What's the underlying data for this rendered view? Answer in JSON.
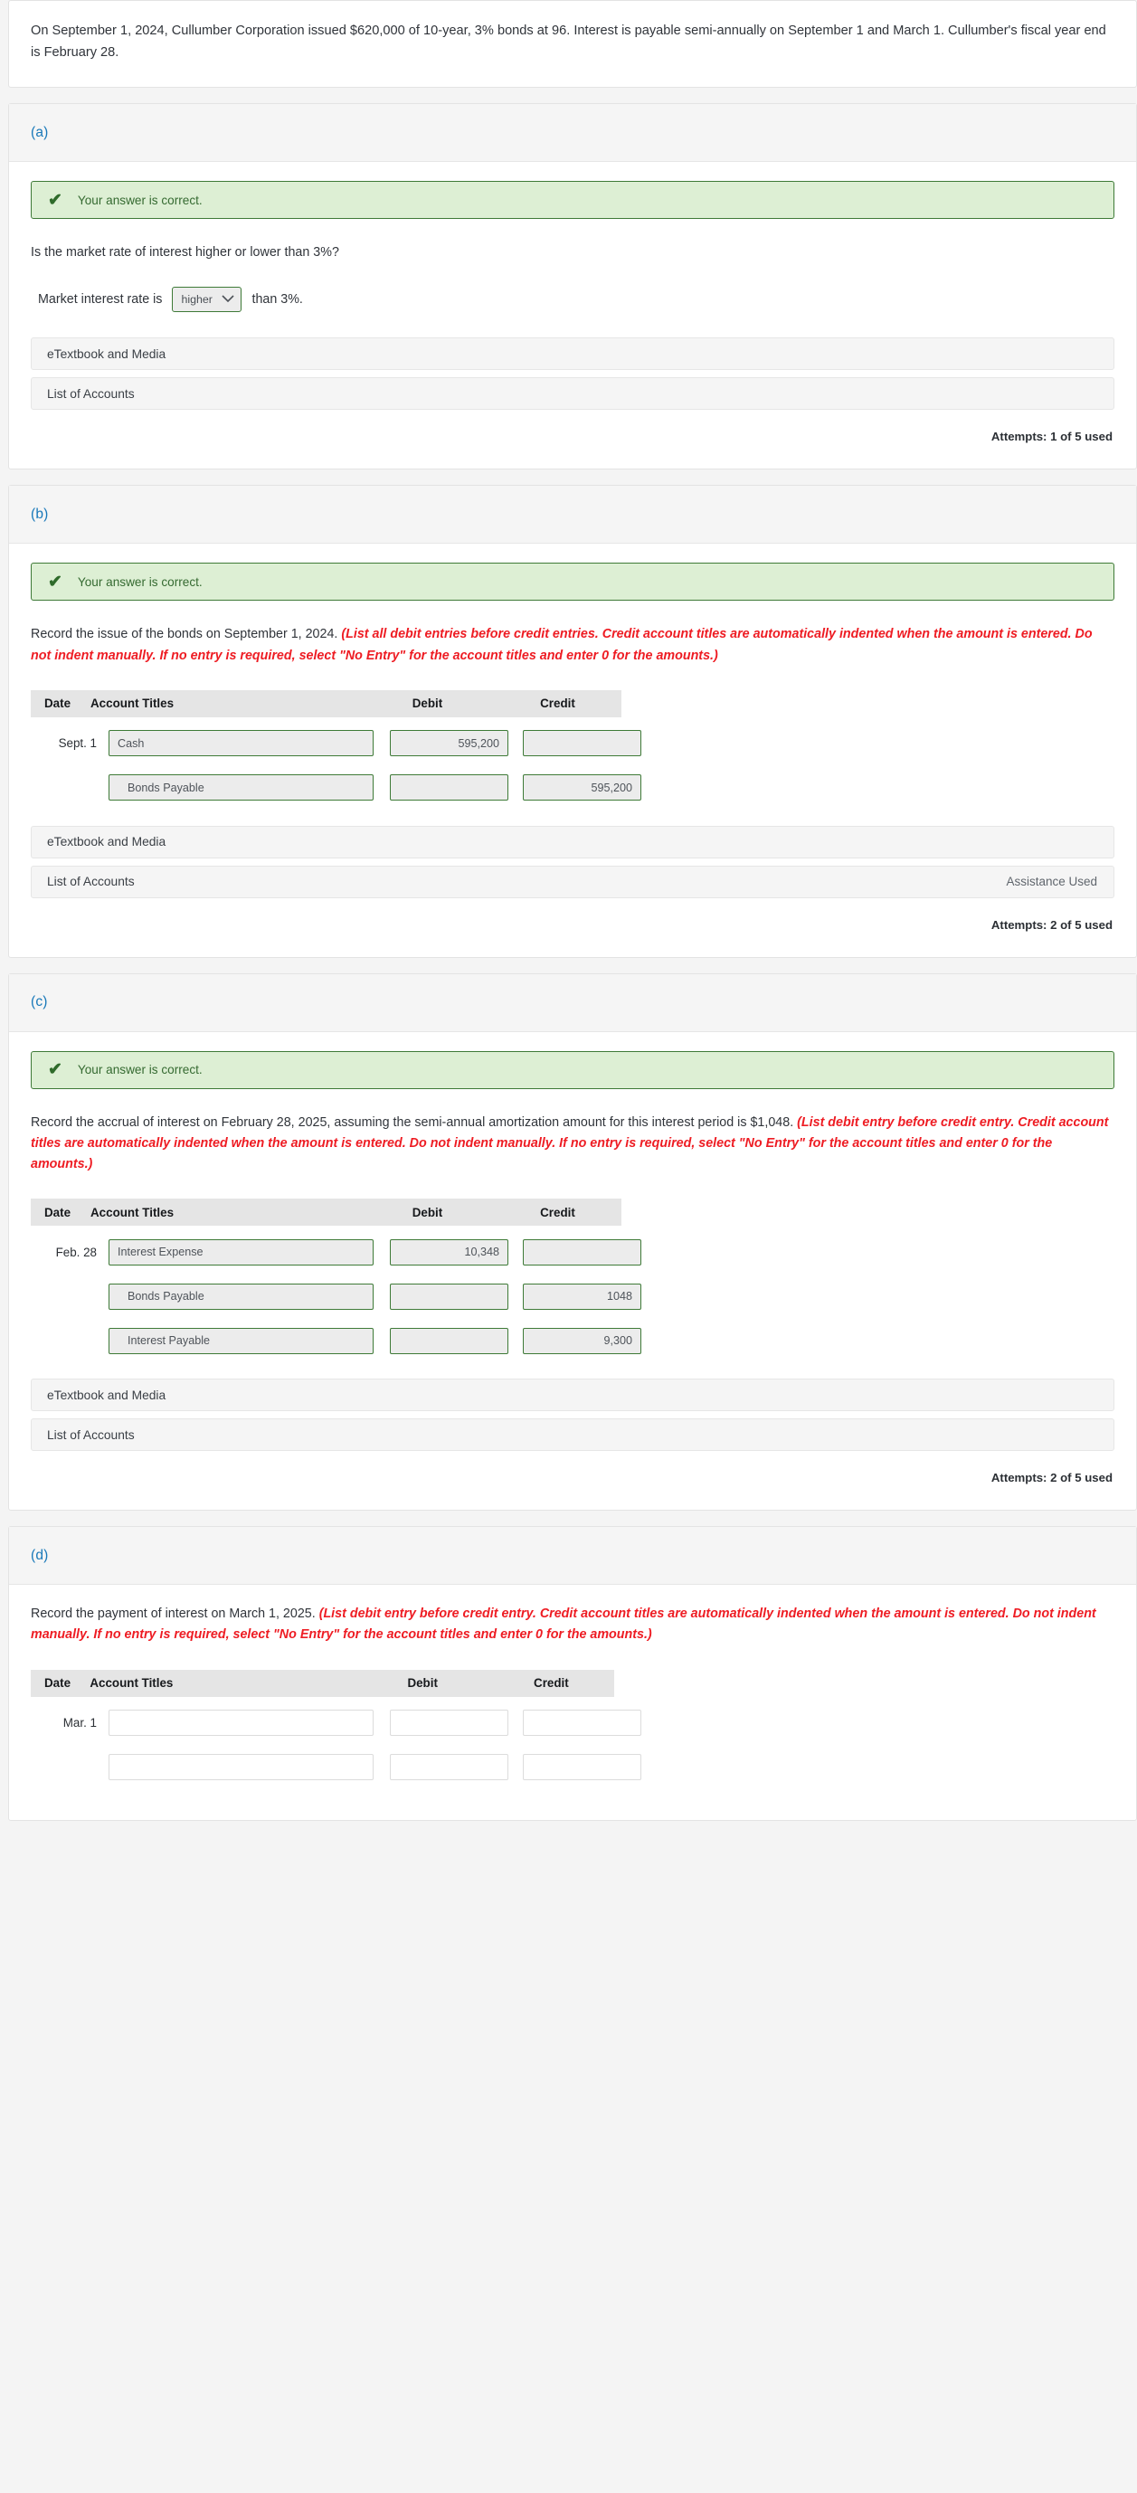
{
  "intro": {
    "text": "On September 1, 2024, Cullumber Corporation issued $620,000 of 10-year, 3% bonds at 96. Interest is payable semi-annually on September 1 and March 1. Cullumber's fiscal year end is February 28."
  },
  "success_message": "Your answer is correct.",
  "check_icon": "check-icon",
  "chevron_icon": "chevron-down-icon",
  "table_headers": {
    "date": "Date",
    "account_titles": "Account Titles",
    "debit": "Debit",
    "credit": "Credit"
  },
  "buttons": {
    "etextbook": "eTextbook and Media",
    "list_of_accounts": "List of Accounts",
    "assistance_used": "Assistance Used"
  },
  "parts": [
    {
      "letter": "(a)",
      "question": "Is the market rate of interest higher or lower than 3%?",
      "prefix_label": "Market interest rate is",
      "suffix_label": "than 3%.",
      "select_value": "higher",
      "select_options": [
        "higher",
        "lower"
      ],
      "attempts": "Attempts: 1 of 5 used"
    },
    {
      "letter": "(b)",
      "prompt_plain": "Record the issue of the bonds on September 1, 2024. ",
      "prompt_red": "(List all debit entries before credit entries. Credit account titles are automatically indented when the amount is entered. Do not indent manually. If no entry is required, select \"No Entry\" for the account titles and enter 0 for the amounts.)",
      "attempts": "Attempts: 2 of 5 used",
      "assistance_used": true,
      "rows": [
        {
          "date": "Sept. 1",
          "account": "Cash",
          "indent": false,
          "debit": "595,200",
          "credit": ""
        },
        {
          "date": "",
          "account": "Bonds Payable",
          "indent": true,
          "debit": "",
          "credit": "595,200"
        }
      ]
    },
    {
      "letter": "(c)",
      "prompt_plain": "Record the accrual of interest on February 28, 2025, assuming the semi-annual amortization amount for this interest period is $1,048. ",
      "prompt_red": "(List debit entry before credit entry. Credit account titles are automatically indented when the amount is entered. Do not indent manually. If no entry is required, select \"No Entry\" for the account titles and enter 0 for the amounts.)",
      "attempts": "Attempts: 2 of 5 used",
      "assistance_used": false,
      "rows": [
        {
          "date": "Feb. 28",
          "account": "Interest Expense",
          "indent": false,
          "debit": "10,348",
          "credit": ""
        },
        {
          "date": "",
          "account": "Bonds Payable",
          "indent": true,
          "debit": "",
          "credit": "1048"
        },
        {
          "date": "",
          "account": "Interest Payable",
          "indent": true,
          "debit": "",
          "credit": "9,300"
        }
      ]
    },
    {
      "letter": "(d)",
      "prompt_plain": "Record the payment of interest on March 1, 2025. ",
      "prompt_red": "(List debit entry before credit entry. Credit account titles are automatically indented when the amount is entered. Do not indent manually. If no entry is required, select \"No Entry\" for the account titles and enter 0 for the amounts.)",
      "rows": [
        {
          "date": "Mar. 1",
          "account": "",
          "indent": false,
          "debit": "",
          "credit": ""
        },
        {
          "date": "",
          "account": "",
          "indent": false,
          "debit": "",
          "credit": ""
        }
      ]
    }
  ],
  "colors": {
    "accent_blue": "#1878b9",
    "success_green": "#3e7a37",
    "success_bg": "#ddefd4",
    "red_instruction": "#ee1c23",
    "header_gray": "#e5e5e5"
  }
}
